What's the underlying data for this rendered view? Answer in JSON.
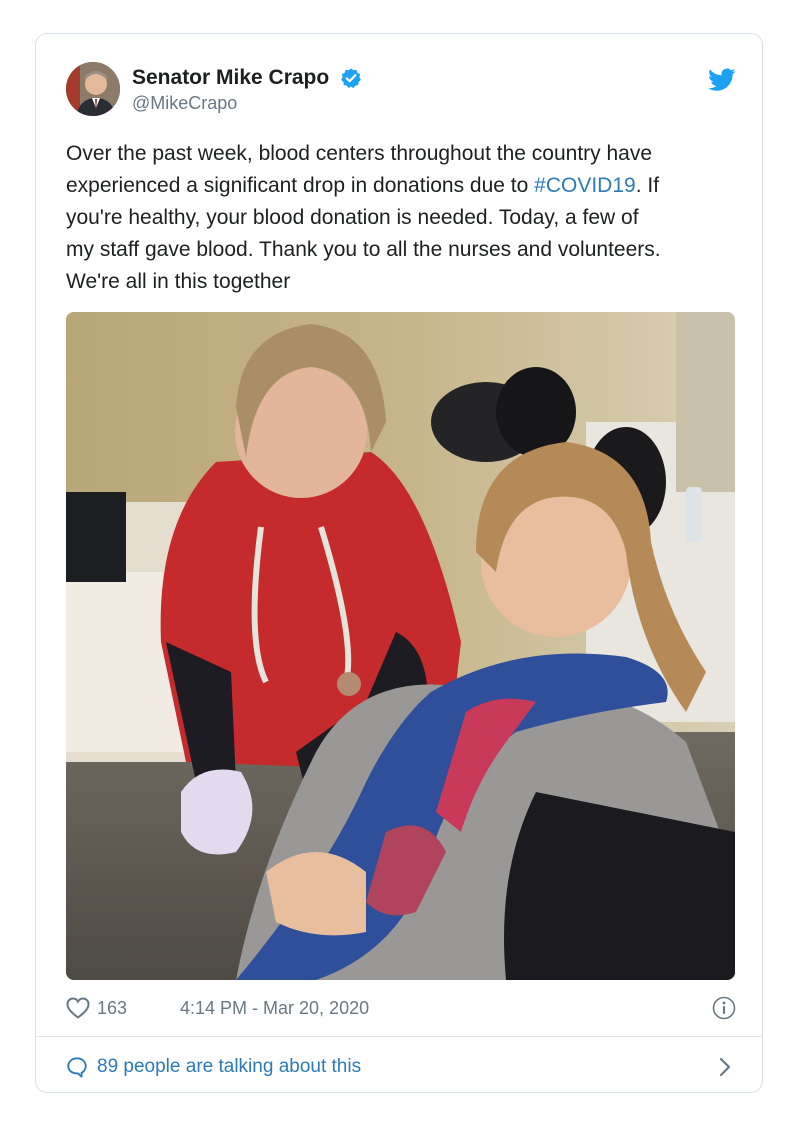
{
  "tweet": {
    "author": {
      "display_name": "Senator Mike Crapo",
      "handle": "@MikeCrapo",
      "verified": true,
      "avatar_icon": "avatar-photo"
    },
    "text_lines": [
      [
        {
          "text": "Over the past week, blood centers throughout the country have"
        }
      ],
      [
        {
          "text": "experienced a significant drop in donations due to "
        },
        {
          "text": "#COVID19",
          "hashtag": true
        },
        {
          "text": ". If"
        }
      ],
      [
        {
          "text": "you're healthy, your blood donation is needed. Today, a few of"
        }
      ],
      [
        {
          "text": "my staff gave blood. Thank you to all the nurses and volunteers."
        }
      ],
      [
        {
          "text": "We're all in this together"
        }
      ]
    ],
    "likes": "163",
    "timestamp": "4:14 PM - Mar 20, 2020",
    "talking": "89 people are talking about this"
  },
  "colors": {
    "link": "#2b7bb9",
    "muted": "#697882",
    "verified": "#1da1f2",
    "twitter_blue": "#1da1f2",
    "border": "#d9e1e8"
  },
  "icons": {
    "brand": "twitter-bird-icon",
    "verified": "verified-badge-icon",
    "like": "heart-icon",
    "info": "info-icon",
    "conversation": "speech-bubble-icon",
    "more": "chevron-right-icon"
  }
}
